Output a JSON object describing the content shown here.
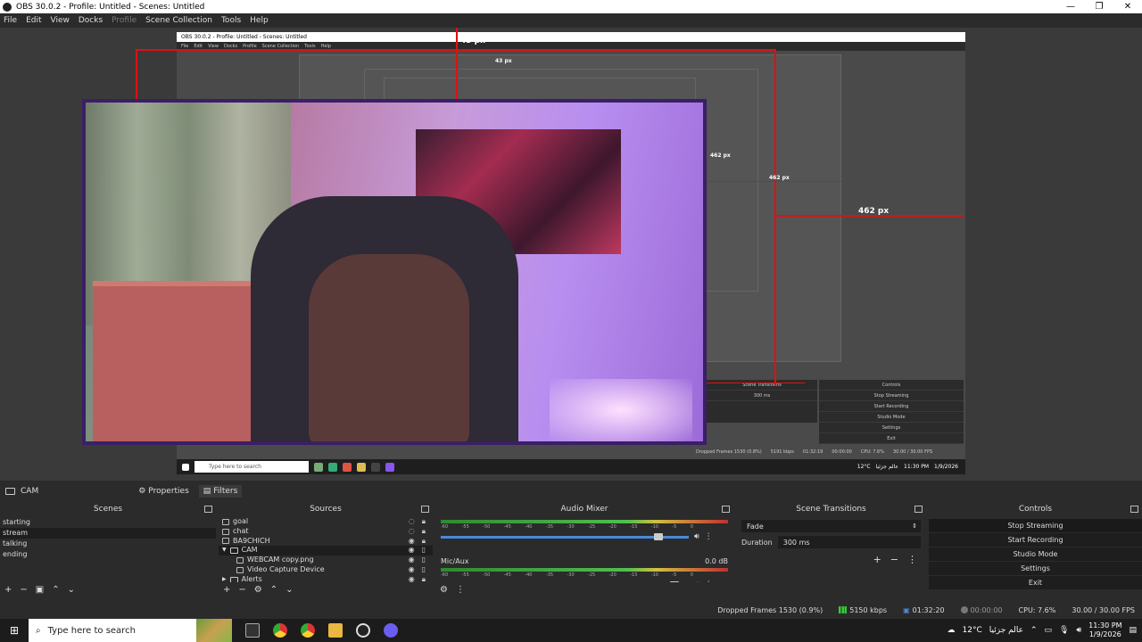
{
  "window": {
    "title": "OBS 30.0.2 - Profile: Untitled - Scenes: Untitled",
    "controls": [
      "—",
      "❐",
      "✕"
    ]
  },
  "menu": {
    "items": [
      "File",
      "Edit",
      "View",
      "Docks"
    ],
    "profile": "Profile",
    "items2": [
      "Scene Collection",
      "Tools",
      "Help"
    ]
  },
  "preview": {
    "nested_title": "OBS 30.0.2 - Profile: Untitled - Scenes: Untitled",
    "nested_menu": [
      "File",
      "Edit",
      "View",
      "Docks",
      "Profile",
      "Scene Collection",
      "Tools",
      "Help"
    ],
    "guide_top": "43 px",
    "guide_top_small": "43 px",
    "guide_right": "462 px",
    "guide_right_small": "462 px",
    "guide_right_tiny": "462 px",
    "mini_search": "Type here to search",
    "mini_status": {
      "dropped": "Dropped Frames 1530 (0.8%)",
      "kbps": "5191 kbps",
      "time": "01:32:19",
      "rec": "00:00:00",
      "cpu": "CPU: 7.6%",
      "fps": "30.00 / 30.00 FPS"
    },
    "mini_tray": {
      "weather": "12°C",
      "arabic": "عالم جزئيا",
      "time": "11:30 PM",
      "date": "1/9/2026"
    },
    "mini_transitions": {
      "title": "Scene Transitions",
      "duration": "300 ms"
    },
    "mini_controls": {
      "title": "Controls",
      "buttons": [
        "Stop Streaming",
        "Start Recording",
        "Studio Mode",
        "Settings",
        "Exit"
      ]
    }
  },
  "cam_bar": {
    "scene_label": "CAM",
    "properties": "Properties",
    "filters": "Filters"
  },
  "scenes": {
    "title": "Scenes",
    "items": [
      "starting",
      "stream",
      "talking",
      "ending"
    ]
  },
  "sources": {
    "title": "Sources",
    "items": [
      {
        "name": "goal",
        "child": false
      },
      {
        "name": "chat",
        "child": false
      },
      {
        "name": "BA9CHICH",
        "child": false
      },
      {
        "name": "CAM",
        "child": false,
        "expanded": true
      },
      {
        "name": "WEBCAM copy.png",
        "child": true
      },
      {
        "name": "Video Capture Device",
        "child": true
      },
      {
        "name": "Alerts",
        "child": false
      }
    ]
  },
  "mixer": {
    "title": "Audio Mixer",
    "ticks": [
      "-60",
      "-55",
      "-50",
      "-45",
      "-40",
      "-35",
      "-30",
      "-25",
      "-20",
      "-15",
      "-10",
      "-5",
      "0"
    ],
    "tracks": [
      {
        "name": "",
        "db": "",
        "level": 0.89
      },
      {
        "name": "Mic/Aux",
        "db": "0.0 dB",
        "level": 0.96
      }
    ]
  },
  "transitions": {
    "title": "Scene Transitions",
    "type": "Fade",
    "duration_label": "Duration",
    "duration": "300 ms"
  },
  "controls": {
    "title": "Controls",
    "buttons": [
      "Stop Streaming",
      "Start Recording",
      "Studio Mode",
      "Settings",
      "Exit"
    ]
  },
  "status": {
    "dropped": "Dropped Frames 1530 (0.9%)",
    "kbps": "5150 kbps",
    "stream_time": "01:32:20",
    "rec_time": "00:00:00",
    "cpu": "CPU: 7.6%",
    "fps": "30.00 / 30.00 FPS"
  },
  "taskbar": {
    "search": "Type here to search",
    "weather": "12°C",
    "arabic": "عالم جزئيا",
    "time": "11:30 PM",
    "date": "1/9/2026"
  },
  "colors": {
    "accent_blue": "#4a8ad8",
    "guide_red": "#e01010",
    "frame_purple": "#3a1f66"
  }
}
